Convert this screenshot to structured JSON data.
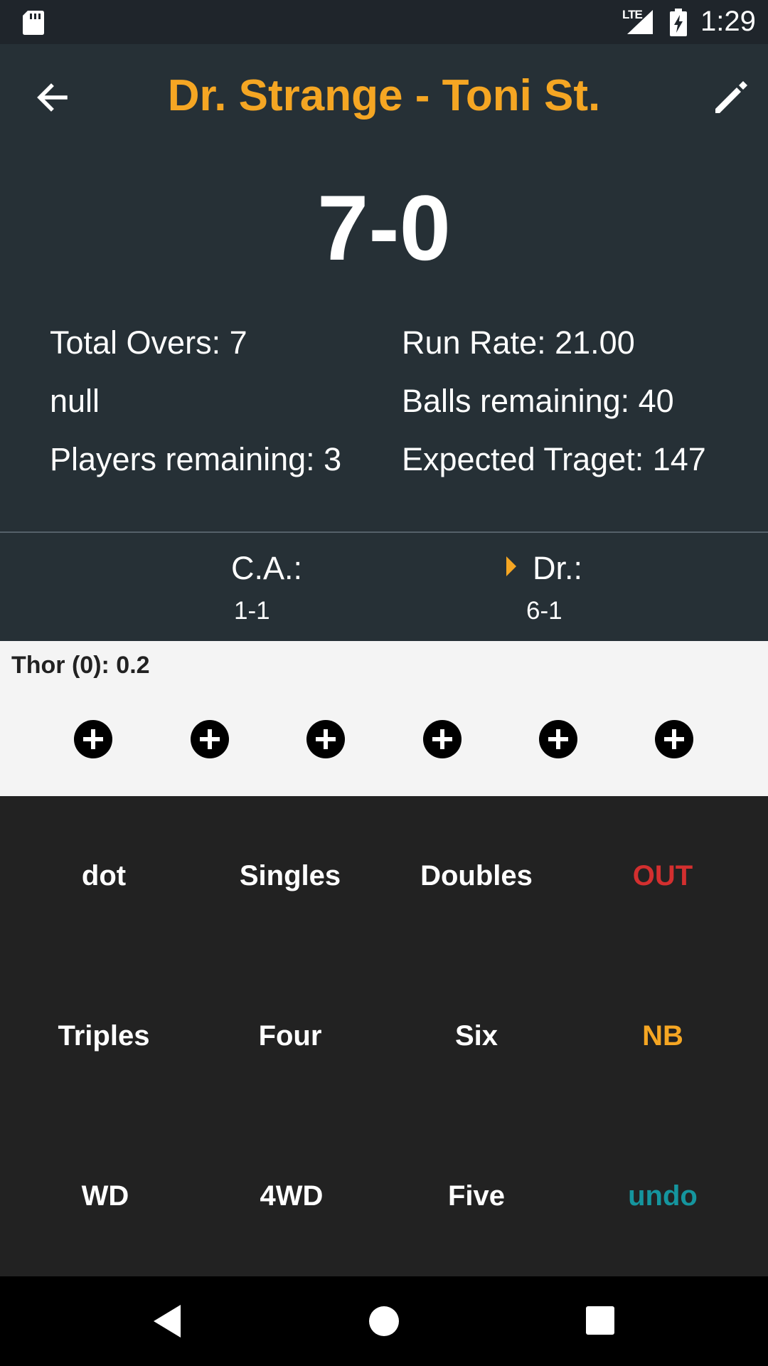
{
  "status": {
    "network": "LTE",
    "time": "1:29"
  },
  "header": {
    "title": "Dr. Strange - Toni St."
  },
  "score": "7-0",
  "stats": {
    "total_overs": "Total Overs: 7",
    "run_rate": "Run Rate: 21.00",
    "null_text": "null",
    "balls_remaining": "Balls remaining: 40",
    "players_remaining": "Players remaining: 3",
    "expected_target": "Expected Traget: 147"
  },
  "batters": [
    {
      "name": "C.A.:",
      "score": "1-1"
    },
    {
      "name": "Dr.:",
      "score": "6-1"
    }
  ],
  "over": {
    "bowler": "Thor (0): 0.2"
  },
  "controls": {
    "dot": "dot",
    "singles": "Singles",
    "doubles": "Doubles",
    "out": "OUT",
    "triples": "Triples",
    "four": "Four",
    "six": "Six",
    "nb": "NB",
    "wd": "WD",
    "fourwd": "4WD",
    "five": "Five",
    "undo": "undo"
  },
  "colors": {
    "accent": "#f5a623",
    "out": "#d32f2f",
    "undo": "#15959e",
    "header_bg": "#263036",
    "controls_bg": "#222222"
  }
}
